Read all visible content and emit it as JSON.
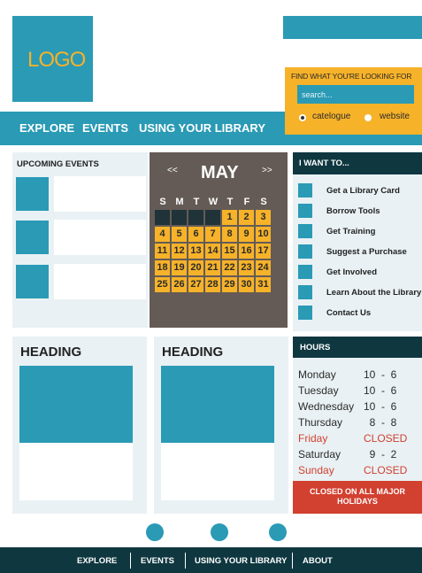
{
  "header": {
    "logo_text": "LOGO",
    "nav": [
      "EXPLORE",
      "EVENTS",
      "USING YOUR LIBRARY"
    ]
  },
  "search": {
    "title": "FIND WHAT YOU'RE LOOKING FOR",
    "placeholder": "search...",
    "options": [
      "catelogue",
      "website"
    ],
    "selected": "catelogue"
  },
  "events": {
    "title": "UPCOMING EVENTS"
  },
  "calendar": {
    "prev": "<<",
    "next": ">>",
    "month": "MAY",
    "weekdays": [
      "S",
      "M",
      "T",
      "W",
      "T",
      "F",
      "S"
    ],
    "leading_blank_days": 4,
    "days": [
      "1",
      "2",
      "3",
      "4",
      "5",
      "6",
      "7",
      "8",
      "9",
      "10",
      "11",
      "12",
      "13",
      "14",
      "15",
      "16",
      "17",
      "18",
      "19",
      "20",
      "21",
      "22",
      "23",
      "24",
      "25",
      "26",
      "27",
      "28",
      "29",
      "30",
      "31"
    ]
  },
  "want": {
    "title": "I WANT TO...",
    "items": [
      "Get a Library Card",
      "Borrow Tools",
      "Get Training",
      "Suggest a Purchase",
      "Get Involved",
      "Learn About the Library",
      "Contact Us"
    ]
  },
  "headings": [
    "HEADING",
    "HEADING"
  ],
  "hours": {
    "title": "HOURS",
    "rows": [
      {
        "day": "Monday",
        "time": "10  -  6",
        "closed": false
      },
      {
        "day": "Tuesday",
        "time": "10  -  6",
        "closed": false
      },
      {
        "day": "Wednesday",
        "time": "10  -  6",
        "closed": false
      },
      {
        "day": "Thursday",
        "time": "  8  -  8",
        "closed": false
      },
      {
        "day": "Friday",
        "time": "CLOSED",
        "closed": true
      },
      {
        "day": "Saturday",
        "time": "  9  -  2",
        "closed": false
      },
      {
        "day": "Sunday",
        "time": "CLOSED",
        "closed": true
      }
    ],
    "notice": "CLOSED ON ALL MAJOR HOLIDAYS"
  },
  "footer": {
    "links": [
      "EXPLORE",
      "EVENTS",
      "USING YOUR LIBRARY",
      "ABOUT"
    ]
  },
  "colors": {
    "primary": "#2a9ab5",
    "accent": "#f6b229",
    "dark": "#0f3740",
    "closed": "#d2402f",
    "calendar_bg": "#645b56",
    "panel_bg": "#e9f1f4"
  }
}
